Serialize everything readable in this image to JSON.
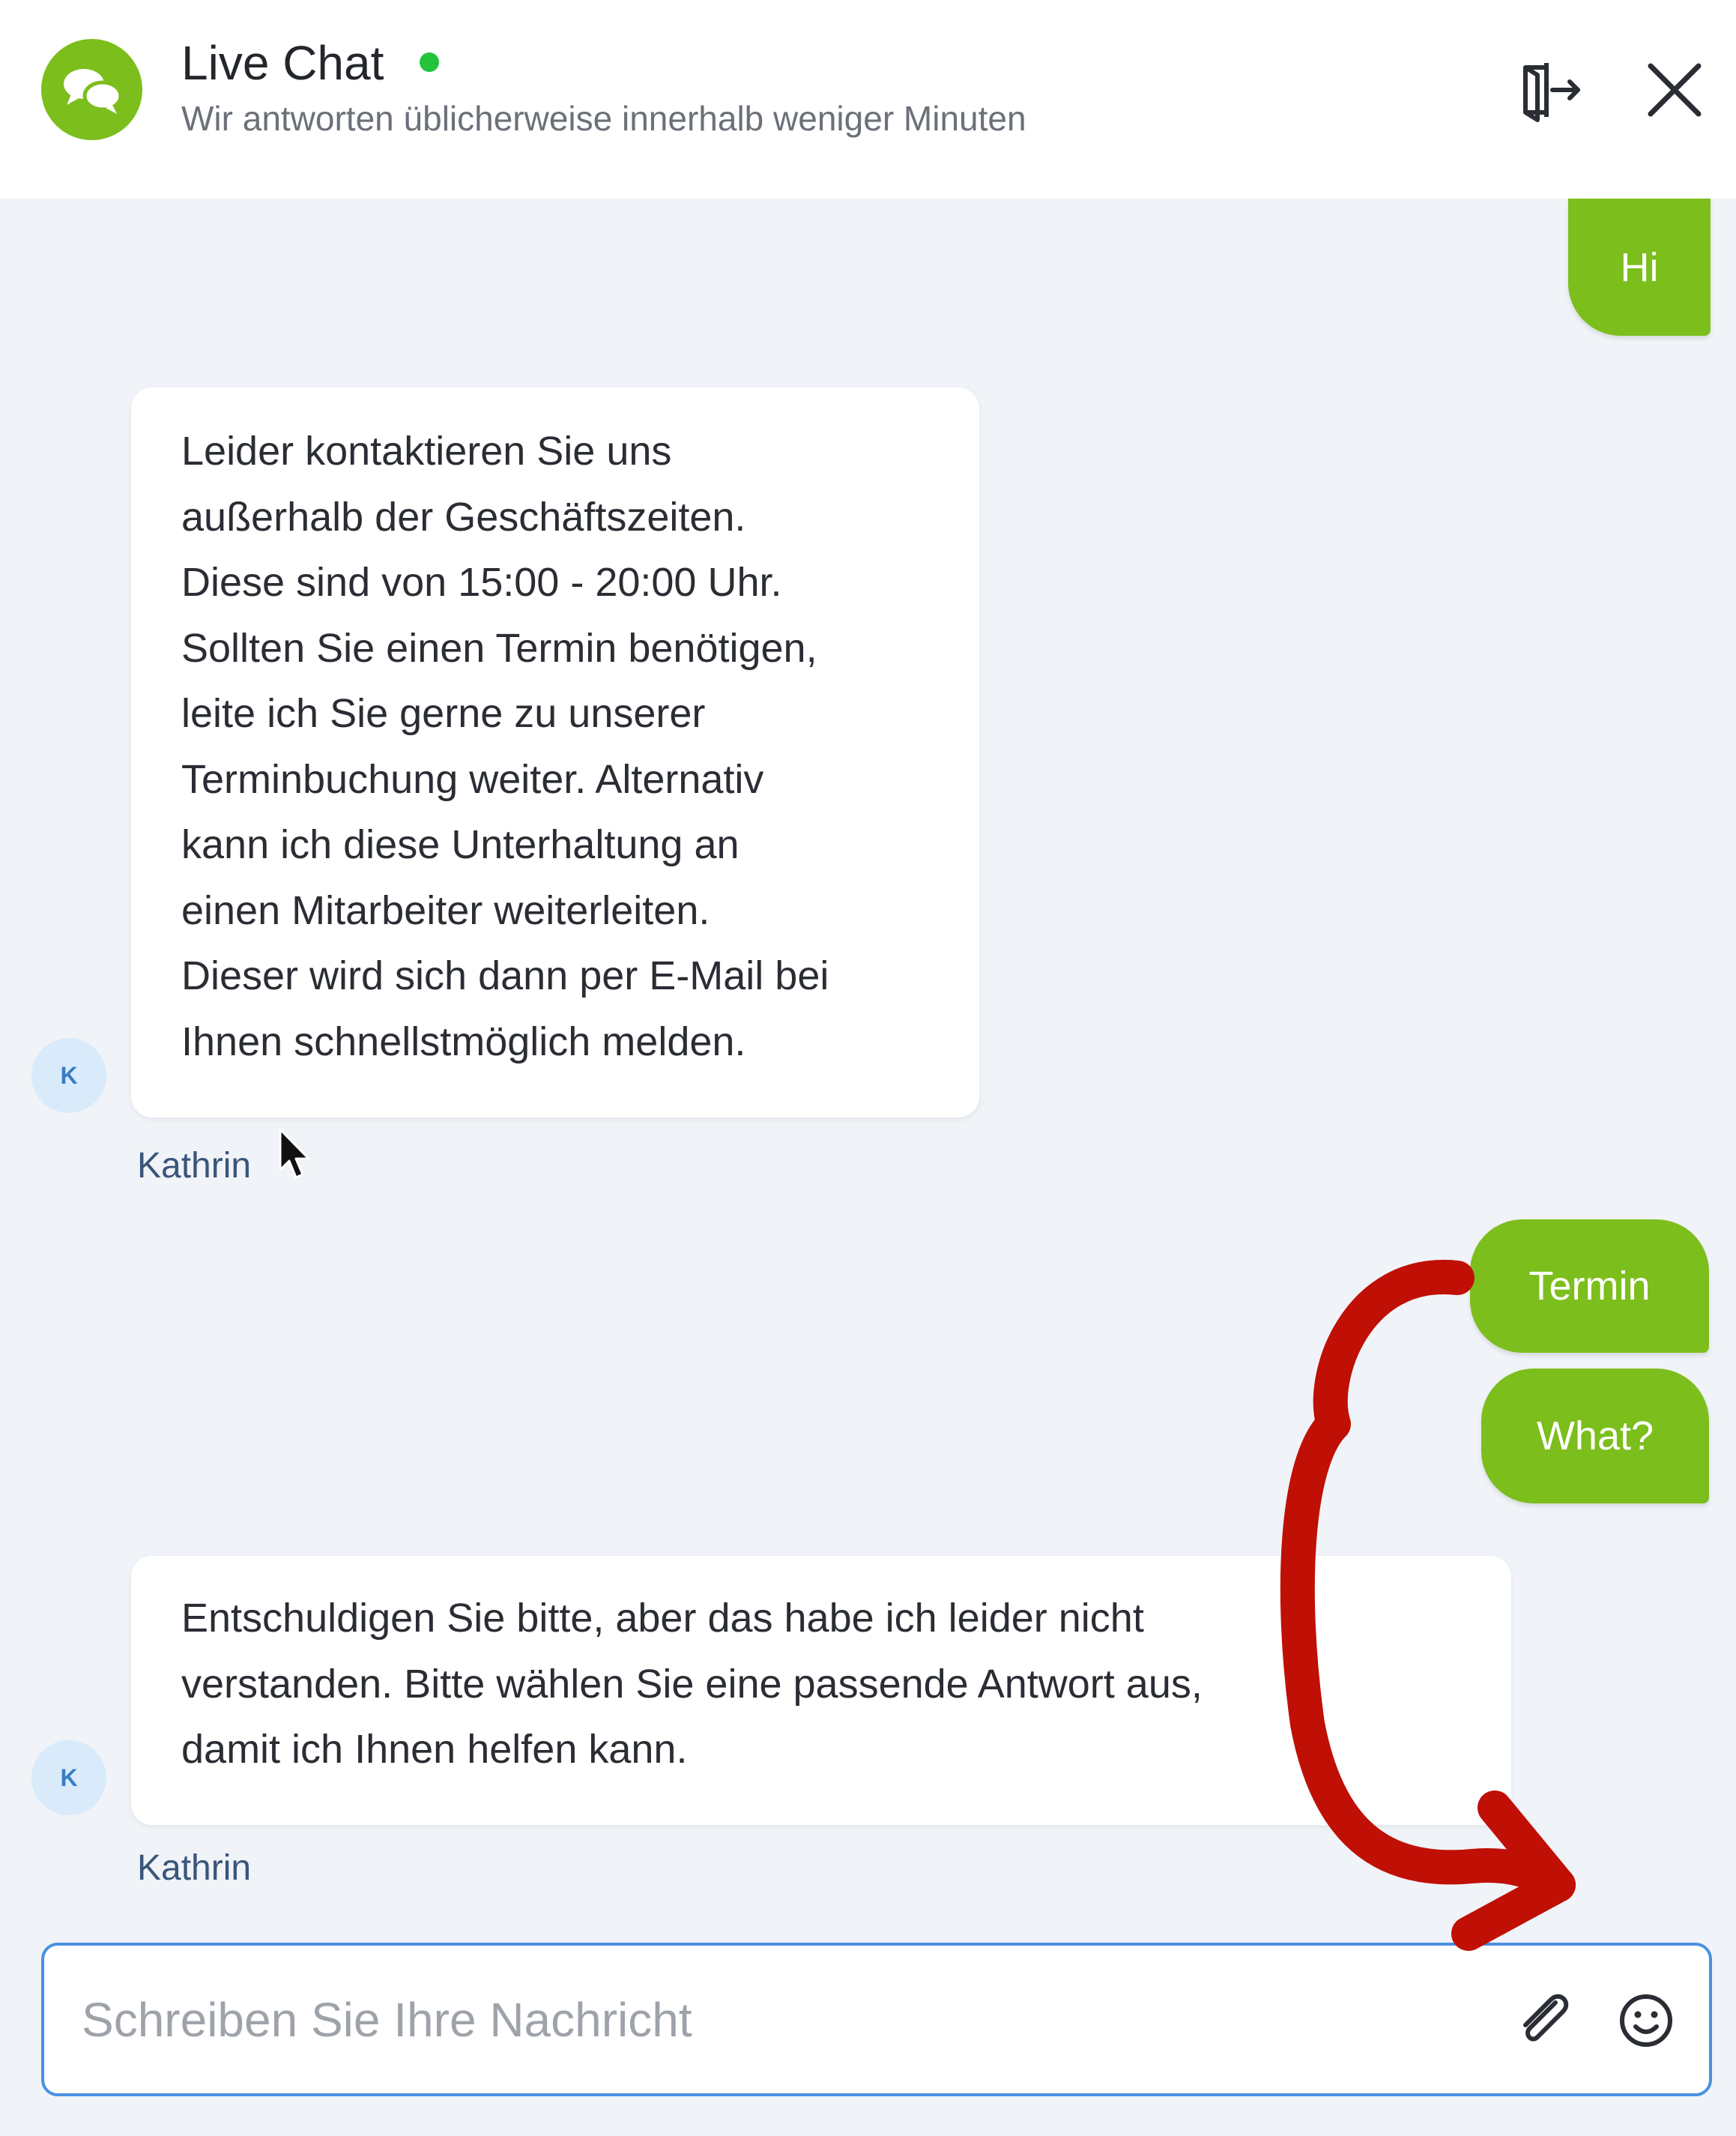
{
  "header": {
    "title": "Live Chat",
    "subtitle": "Wir antworten üblicherweise innerhalb weniger Minuten",
    "logo_icon": "chat-bubbles-icon",
    "exit_icon": "exit-door-icon",
    "close_icon": "close-icon"
  },
  "messages": [
    {
      "from": "user",
      "text": "Hi"
    },
    {
      "from": "agent",
      "avatar": "K",
      "name": "Kathrin",
      "lines": [
        "Leider kontaktieren Sie uns",
        "außerhalb der Geschäftszeiten.",
        "Diese sind von 15:00 - 20:00 Uhr.",
        "Sollten Sie einen Termin benötigen,",
        "leite ich Sie gerne zu unserer",
        "Terminbuchung weiter. Alternativ",
        "kann ich diese Unterhaltung an",
        "einen Mitarbeiter weiterleiten.",
        "Dieser wird sich dann per E-Mail bei",
        "Ihnen schnellstmöglich melden."
      ]
    },
    {
      "from": "user",
      "text": "Termin"
    },
    {
      "from": "user",
      "text": "What?"
    },
    {
      "from": "agent",
      "avatar": "K",
      "name": "Kathrin",
      "lines": [
        "Entschuldigen Sie bitte, aber das habe ich leider nicht",
        "verstanden. Bitte wählen Sie eine passende Antwort aus,",
        "damit ich Ihnen helfen kann."
      ]
    }
  ],
  "composer": {
    "placeholder": "Schreiben Sie Ihre Nachricht",
    "value": "",
    "attach_icon": "paperclip-icon",
    "emoji_icon": "smiley-icon"
  },
  "colors": {
    "accent": "#7cbe1c",
    "online": "#21c43a",
    "chat_background": "#f0f3f7",
    "composer_border": "#4a90e2",
    "annotation": "#c00f05"
  }
}
